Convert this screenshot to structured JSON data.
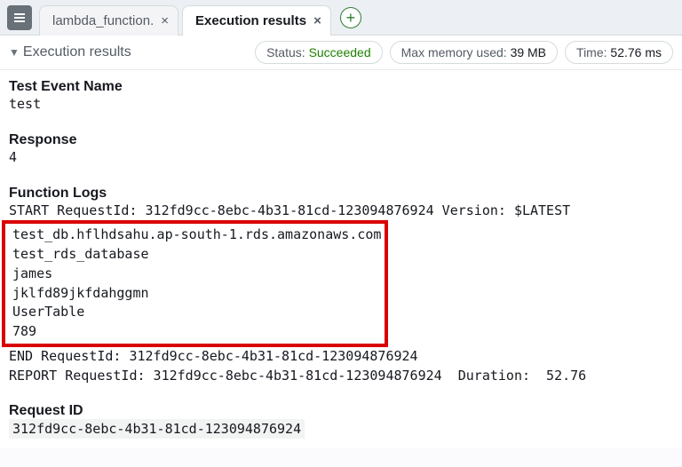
{
  "tabs": {
    "items": [
      {
        "label": "lambda_function."
      },
      {
        "label": "Execution results"
      }
    ]
  },
  "header": {
    "title": "Execution results",
    "status_label": "Status:",
    "status_value": "Succeeded",
    "memory_label": "Max memory used:",
    "memory_value": "39 MB",
    "time_label": "Time:",
    "time_value": "52.76 ms"
  },
  "sections": {
    "test_event_label": "Test Event Name",
    "test_event_value": "test",
    "response_label": "Response",
    "response_value": "4",
    "function_logs_label": "Function Logs",
    "request_id_label": "Request ID",
    "request_id_value": "312fd9cc-8ebc-4b31-81cd-123094876924"
  },
  "logs": {
    "line_start": "START RequestId: 312fd9cc-8ebc-4b31-81cd-123094876924 Version: $LATEST",
    "boxed": [
      "test_db.hflhdsahu.ap-south-1.rds.amazonaws.com",
      "test_rds_database",
      "james",
      "jklfd89jkfdahggmn",
      "UserTable",
      "789"
    ],
    "line_end": "END RequestId: 312fd9cc-8ebc-4b31-81cd-123094876924",
    "line_report": "REPORT RequestId: 312fd9cc-8ebc-4b31-81cd-123094876924  Duration:  52.76"
  }
}
